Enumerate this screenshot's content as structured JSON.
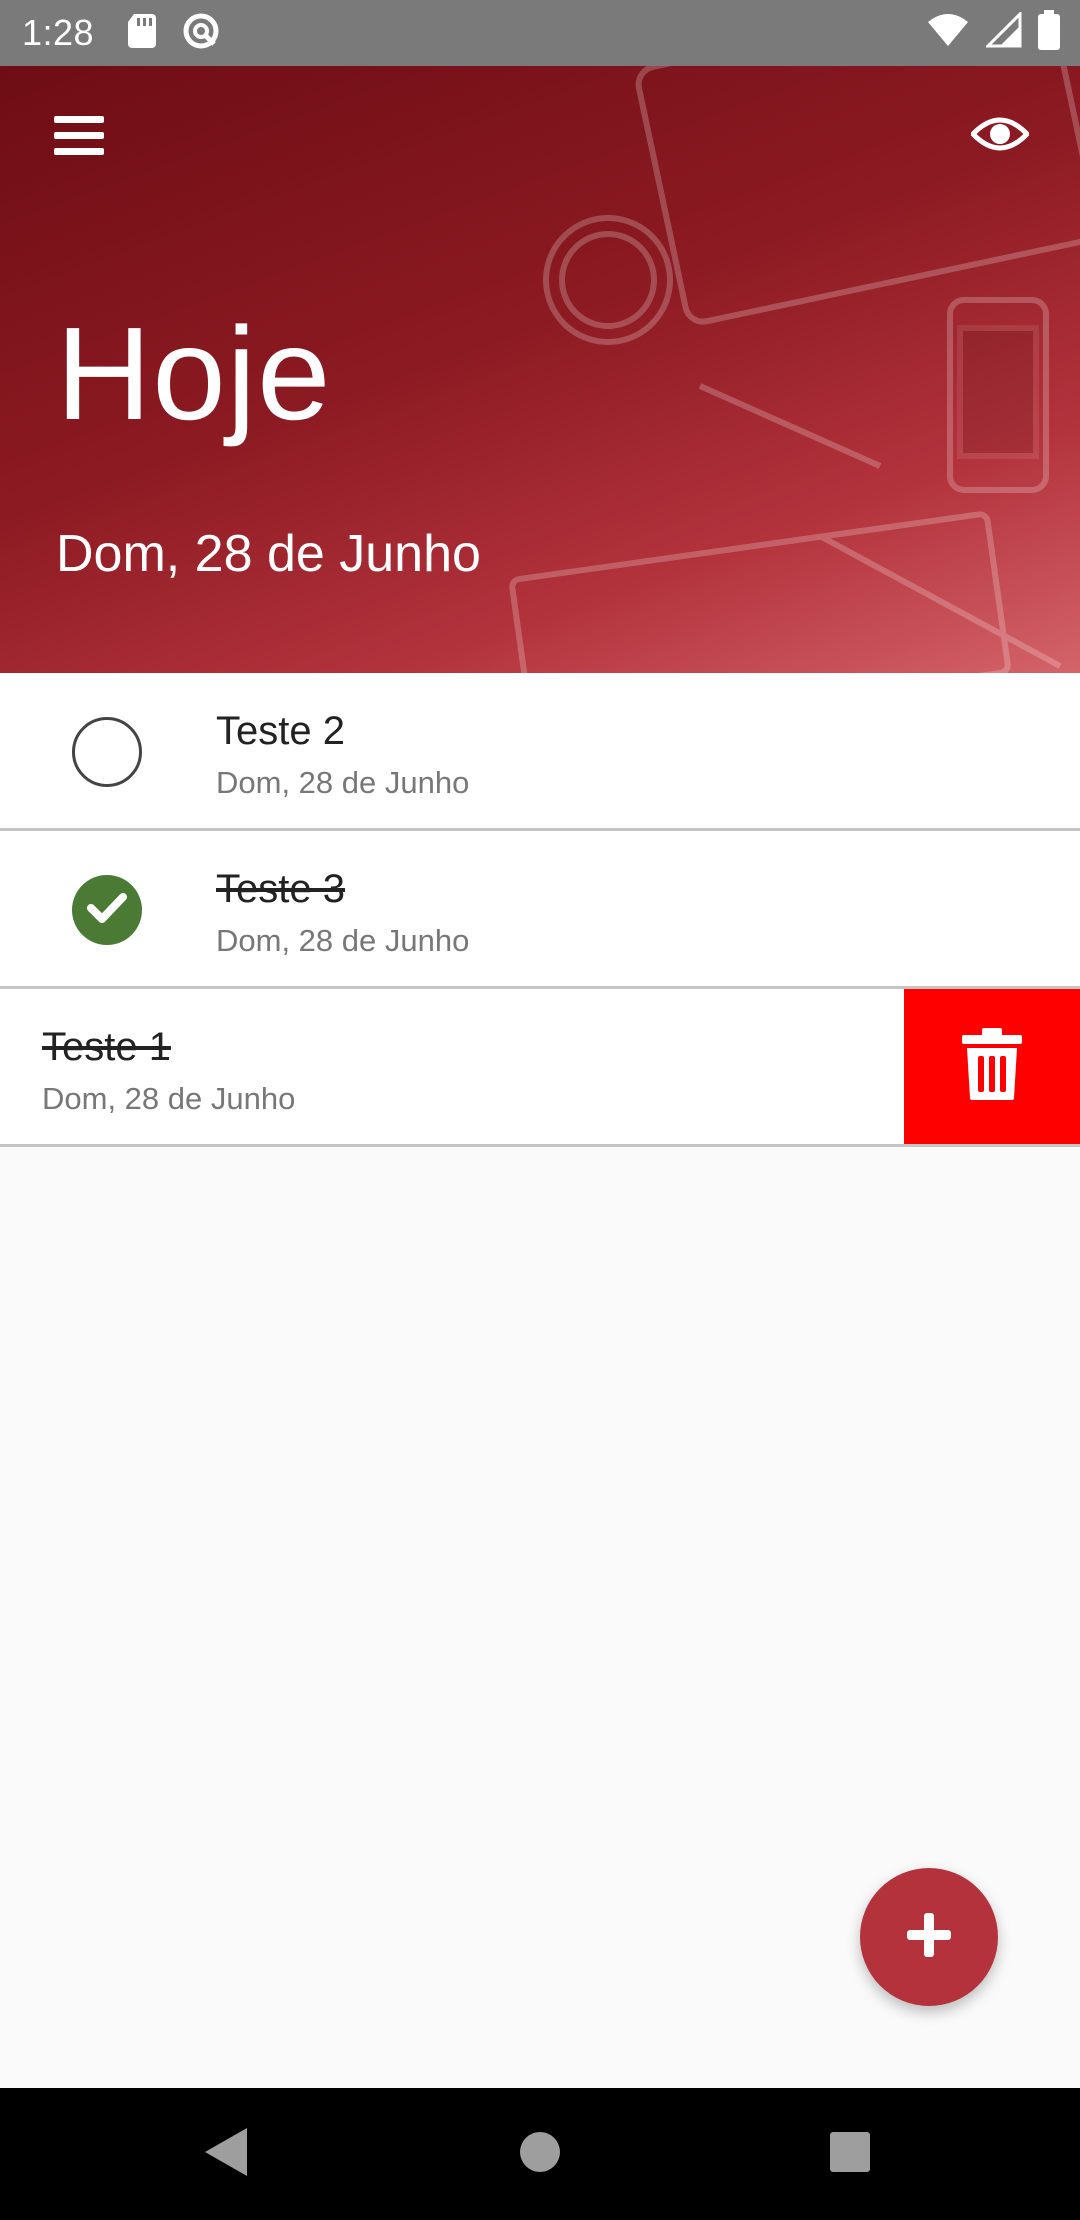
{
  "status_bar": {
    "time": "1:28",
    "icons_left": [
      "sd-card-icon",
      "vpn-key-icon"
    ],
    "icons_right": [
      "wifi-icon",
      "cell-signal-icon",
      "battery-icon"
    ]
  },
  "header": {
    "title": "Hoje",
    "date": "Dom, 28 de Junho",
    "menu_icon": "hamburger-menu-icon",
    "visibility_icon": "eye-icon",
    "gradient_color": "#8c1a22"
  },
  "tasks": [
    {
      "title": "Teste 2",
      "date": "Dom, 28 de Junho",
      "completed": false
    },
    {
      "title": "Teste 3",
      "date": "Dom, 28 de Junho",
      "completed": true
    },
    {
      "title": "Teste 1",
      "date": "Dom, 28 de Junho",
      "completed": true,
      "swiped": true
    }
  ],
  "delete_action": {
    "icon": "trash-icon",
    "color": "#ff0000"
  },
  "fab": {
    "icon": "plus-icon",
    "color": "#b3323c"
  },
  "colors": {
    "done": "#4a7a33",
    "accent": "#b3323c"
  },
  "nav_bar": {
    "icons": [
      "back-icon",
      "home-icon",
      "recents-icon"
    ]
  }
}
